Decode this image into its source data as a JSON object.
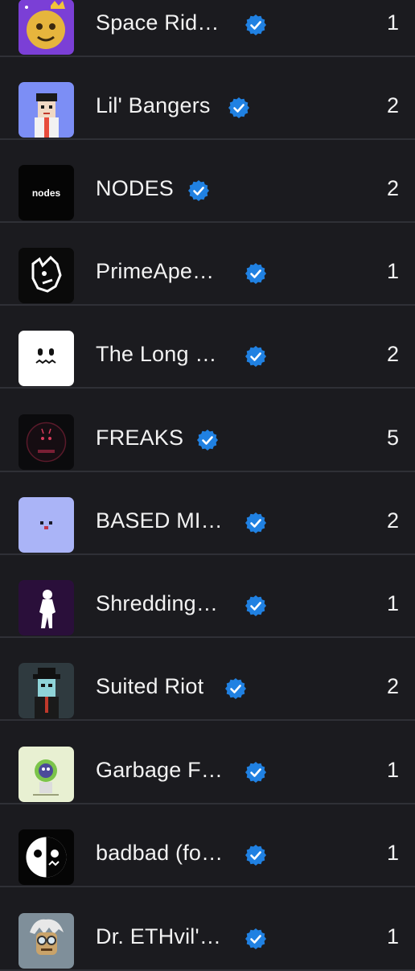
{
  "collections": [
    {
      "name": "Space Rid…",
      "count": "1",
      "icon": "golden-smiley-avatar-icon"
    },
    {
      "name": "Lil' Bangers",
      "count": "2",
      "icon": "pixel-character-avatar-icon"
    },
    {
      "name": "NODES",
      "count": "2",
      "icon": "nodes-logo-icon"
    },
    {
      "name": "PrimeApe…",
      "count": "1",
      "icon": "ape-head-logo-icon"
    },
    {
      "name": "The Long …",
      "count": "2",
      "icon": "ghost-face-icon"
    },
    {
      "name": "FREAKS",
      "count": "5",
      "icon": "freaks-logo-icon"
    },
    {
      "name": "BASED MI…",
      "count": "2",
      "icon": "blue-face-icon"
    },
    {
      "name": "Shredding…",
      "count": "1",
      "icon": "sasquatch-silhouette-icon"
    },
    {
      "name": "Suited Riot",
      "count": "2",
      "icon": "pixel-gentleman-avatar-icon"
    },
    {
      "name": "Garbage F…",
      "count": "1",
      "icon": "garbage-friend-art-icon"
    },
    {
      "name": "badbad (fo…",
      "count": "1",
      "icon": "badbad-face-logo-icon"
    },
    {
      "name": "Dr. ETHvil'…",
      "count": "1",
      "icon": "scientist-avatar-icon"
    }
  ],
  "colors": {
    "background": "#1b1b1f",
    "divider": "#2f3036",
    "verified_badge": "#2081e2",
    "text": "#f2f2f2"
  },
  "verified_icon": "verified-badge-icon"
}
